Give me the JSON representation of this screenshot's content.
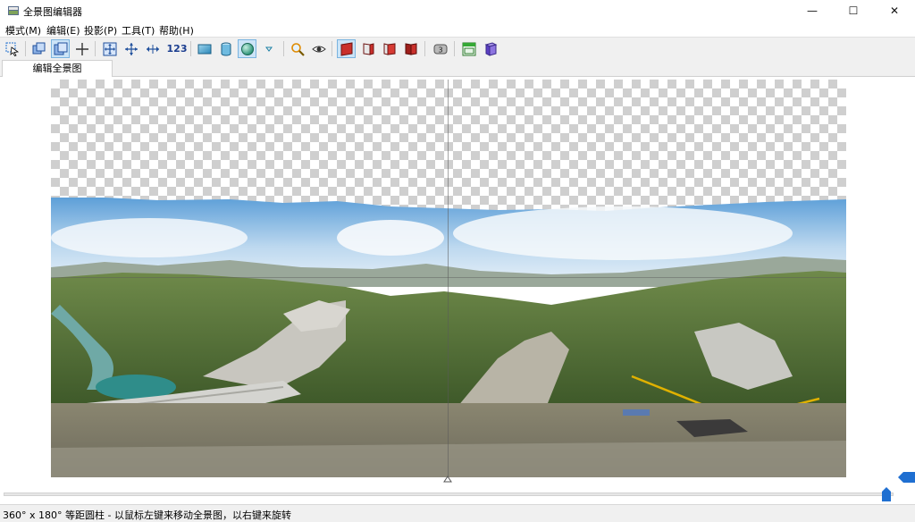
{
  "window": {
    "title": "全景图编辑器",
    "minimize": "—",
    "maximize": "☐",
    "close": "✕"
  },
  "menu": {
    "items": [
      "模式(M)",
      "编辑(E)",
      "投影(P)",
      "工具(T)",
      "帮助(H)"
    ]
  },
  "toolbar": {
    "projection_zoom": "123",
    "icons": [
      "select-arrow-icon",
      "layers-icon",
      "move-panel-icon",
      "crosshair-icon",
      "fit-to-window-icon",
      "center-move-icon",
      "horizontal-stretch-icon",
      "projection-zoom-text",
      "rectangle-projection-icon",
      "cylinder-icon",
      "sphere-icon",
      "dropdown-arrow-icon",
      "zoom-icon",
      "eye-icon",
      "cube-face-1-icon",
      "cube-face-2-icon",
      "cube-face-3-icon",
      "cube-face-4-icon",
      "badge-3-icon",
      "window-icon",
      "book-icon"
    ]
  },
  "tabs": {
    "active": "编辑全景图"
  },
  "status": {
    "text": "360° x 180° 等距圆柱 - 以鼠标左键来移动全景图，以右键来旋转"
  },
  "colors": {
    "accent_blue": "#1f6fd1",
    "active_bg": "#cce4f7",
    "checker": "#cfcfcf"
  }
}
